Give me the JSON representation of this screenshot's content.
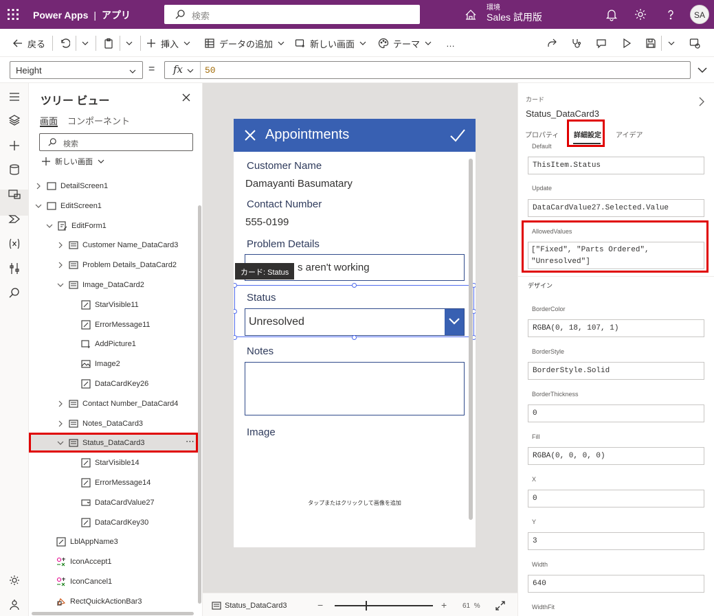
{
  "topbar": {
    "brand": "Power Apps",
    "app_crumb": "アプリ",
    "search_placeholder": "検索",
    "env_label": "環境",
    "env_name": "Sales 試用版",
    "avatar": "SA"
  },
  "commands": {
    "back": "戻る",
    "insert": "挿入",
    "add_data": "データの追加",
    "new_screen": "新しい画面",
    "theme": "テーマ",
    "more": "…"
  },
  "formula": {
    "property": "Height",
    "equals": "=",
    "fx": "fx",
    "value": "50"
  },
  "tree": {
    "title": "ツリー ビュー",
    "tab_screens": "画面",
    "tab_components": "コンポーネント",
    "search_placeholder": "検索",
    "new_screen": "新しい画面",
    "nodes": [
      {
        "label": "DetailScreen1"
      },
      {
        "label": "EditScreen1"
      },
      {
        "label": "EditForm1"
      },
      {
        "label": "Customer Name_DataCard3"
      },
      {
        "label": "Problem Details_DataCard2"
      },
      {
        "label": "Image_DataCard2"
      },
      {
        "label": "StarVisible11"
      },
      {
        "label": "ErrorMessage11"
      },
      {
        "label": "AddPicture1"
      },
      {
        "label": "Image2"
      },
      {
        "label": "DataCardKey26"
      },
      {
        "label": "Contact Number_DataCard4"
      },
      {
        "label": "Notes_DataCard3"
      },
      {
        "label": "Status_DataCard3"
      },
      {
        "label": "StarVisible14"
      },
      {
        "label": "ErrorMessage14"
      },
      {
        "label": "DataCardValue27"
      },
      {
        "label": "DataCardKey30"
      },
      {
        "label": "LblAppName3"
      },
      {
        "label": "IconAccept1"
      },
      {
        "label": "IconCancel1"
      },
      {
        "label": "RectQuickActionBar3"
      }
    ],
    "more": "⋯"
  },
  "app": {
    "title": "Appointments",
    "customer_name_label": "Customer Name",
    "customer_name_value": "Damayanti Basumatary",
    "contact_label": "Contact Number",
    "contact_value": "555-0199",
    "problem_label": "Problem Details",
    "problem_value": "s aren't working",
    "status_label": "Status",
    "status_value": "Unresolved",
    "notes_label": "Notes",
    "image_label": "Image",
    "image_hint": "タップまたはクリックして画像を追加",
    "tooltip": "カード: Status",
    "header_color": "#3860b2"
  },
  "footer": {
    "screen_name": "Status_DataCard3",
    "zoom_minus": "−",
    "zoom_plus": "+",
    "zoom": "61",
    "zoom_unit": "%"
  },
  "props": {
    "card_label": "カード",
    "card_name": "Status_DataCard3",
    "tab_properties": "プロパティ",
    "tab_advanced": "詳細設定",
    "tab_ideas": "アイデア",
    "default_label": "Default",
    "default_value": "ThisItem.Status",
    "update_label": "Update",
    "update_value": "DataCardValue27.Selected.Value",
    "allowed_label": "AllowedValues",
    "allowed_line1": "[\"Fixed\", \"Parts Ordered\",",
    "allowed_line2": "\"Unresolved\"]",
    "design_header": "デザイン",
    "bordercolor_label": "BorderColor",
    "bordercolor_value": "RGBA(0, 18, 107, 1)",
    "borderstyle_label": "BorderStyle",
    "borderstyle_value": "BorderStyle.Solid",
    "borderthickness_label": "BorderThickness",
    "borderthickness_value": "0",
    "fill_label": "Fill",
    "fill_value": "RGBA(0, 0, 0, 0)",
    "x_label": "X",
    "x_value": "0",
    "y_label": "Y",
    "y_value": "3",
    "width_label": "Width",
    "width_value": "640",
    "widthfit_label": "WidthFit"
  },
  "colors": {
    "topbar": "#742774",
    "highlight": "#e00000",
    "selection": "#4f6bed"
  }
}
